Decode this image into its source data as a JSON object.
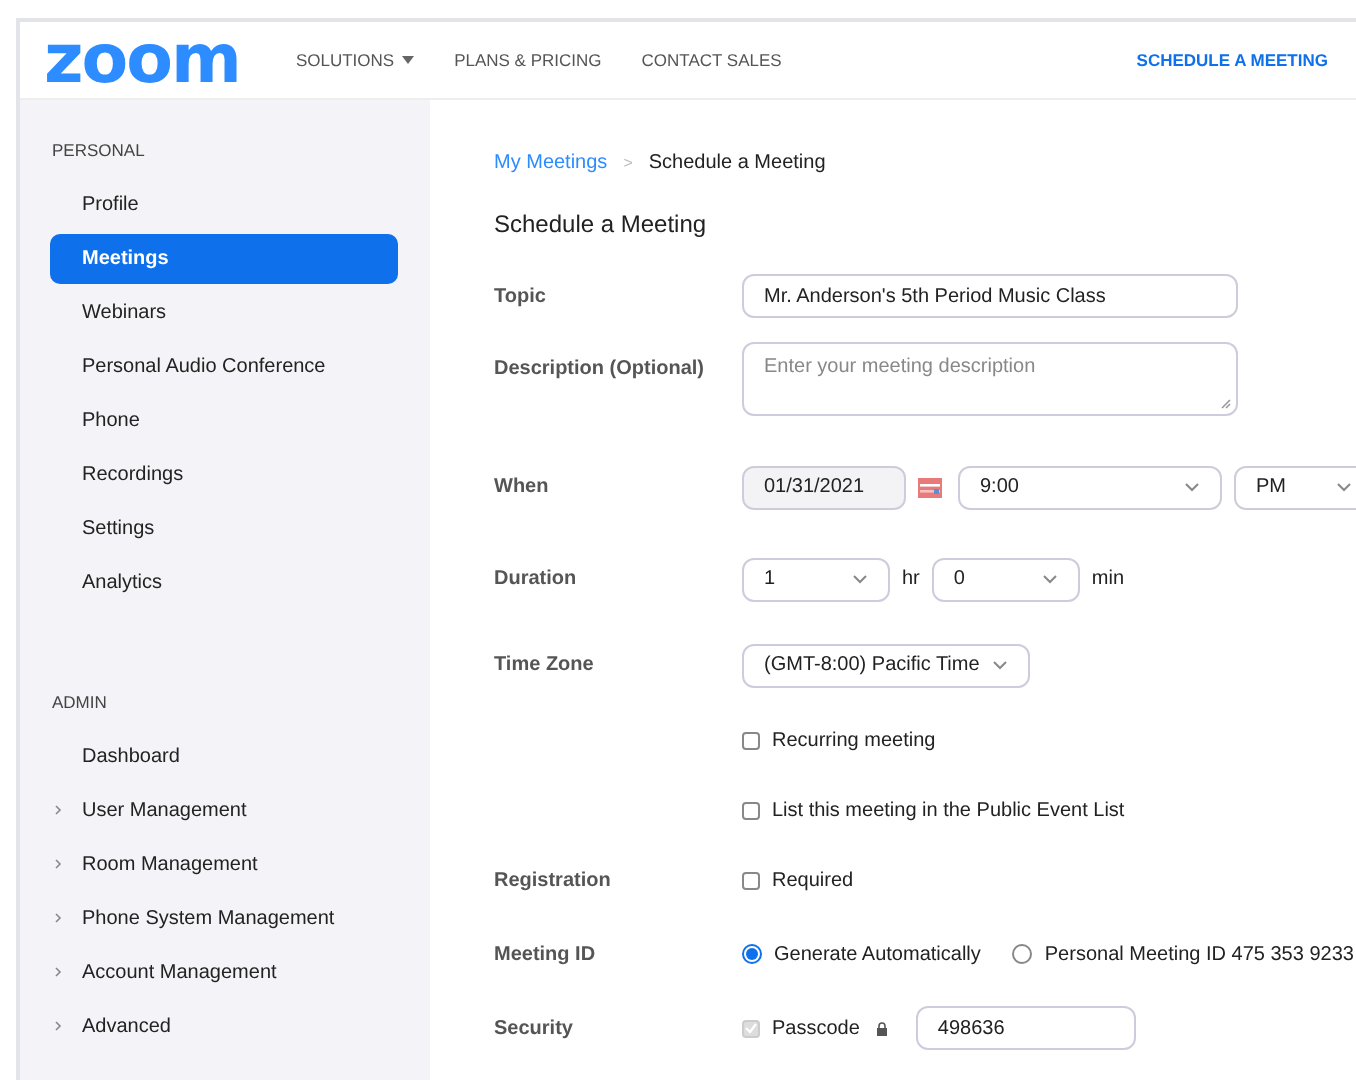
{
  "header": {
    "logo": "zoom",
    "nav": [
      {
        "label": "SOLUTIONS",
        "dropdown": true
      },
      {
        "label": "PLANS & PRICING",
        "dropdown": false
      },
      {
        "label": "CONTACT SALES",
        "dropdown": false
      }
    ],
    "action": "SCHEDULE A MEETING"
  },
  "sidebar": {
    "sections": [
      {
        "title": "PERSONAL",
        "items": [
          {
            "label": "Profile",
            "selected": false,
            "expandable": false
          },
          {
            "label": "Meetings",
            "selected": true,
            "expandable": false
          },
          {
            "label": "Webinars",
            "selected": false,
            "expandable": false
          },
          {
            "label": "Personal Audio Conference",
            "selected": false,
            "expandable": false
          },
          {
            "label": "Phone",
            "selected": false,
            "expandable": false
          },
          {
            "label": "Recordings",
            "selected": false,
            "expandable": false
          },
          {
            "label": "Settings",
            "selected": false,
            "expandable": false
          },
          {
            "label": "Analytics",
            "selected": false,
            "expandable": false
          }
        ]
      },
      {
        "title": "ADMIN",
        "items": [
          {
            "label": "Dashboard",
            "selected": false,
            "expandable": false
          },
          {
            "label": "User Management",
            "selected": false,
            "expandable": true
          },
          {
            "label": "Room Management",
            "selected": false,
            "expandable": true
          },
          {
            "label": "Phone System Management",
            "selected": false,
            "expandable": true
          },
          {
            "label": "Account Management",
            "selected": false,
            "expandable": true
          },
          {
            "label": "Advanced",
            "selected": false,
            "expandable": true
          }
        ]
      }
    ]
  },
  "breadcrumb": {
    "link": "My Meetings",
    "separator": ">",
    "current": "Schedule a Meeting"
  },
  "title": "Schedule a Meeting",
  "form": [
    {
      "kind": "text",
      "label": "Topic",
      "value": "Mr. Anderson's 5th Period Music Class"
    },
    {
      "kind": "textarea",
      "label": "Description (Optional)",
      "placeholder": "Enter your meeting description"
    },
    {
      "kind": "when",
      "label": "When",
      "date": "01/31/2021",
      "time": "9:00",
      "ampm": "PM"
    },
    {
      "kind": "duration",
      "label": "Duration",
      "hours": "1",
      "hours_unit": "hr",
      "minutes": "0",
      "minutes_unit": "min"
    },
    {
      "kind": "select",
      "label": "Time Zone",
      "value": "(GMT-8:00) Pacific Time"
    },
    {
      "kind": "checkbox",
      "text": "Recurring meeting",
      "checked": false,
      "disabled": false
    },
    {
      "kind": "checkbox",
      "text": "List this meeting in the Public Event List",
      "checked": false,
      "disabled": false
    },
    {
      "kind": "checkbox",
      "label": "Registration",
      "text": "Required",
      "checked": false,
      "disabled": false
    },
    {
      "kind": "radio",
      "label": "Meeting ID",
      "options": [
        {
          "text": "Generate Automatically",
          "selected": true
        },
        {
          "text": "Personal Meeting ID 475 353 9233",
          "selected": false
        }
      ]
    },
    {
      "kind": "security",
      "label": "Security",
      "text": "Passcode",
      "checked": true,
      "disabled": true,
      "value": "498636"
    }
  ]
}
